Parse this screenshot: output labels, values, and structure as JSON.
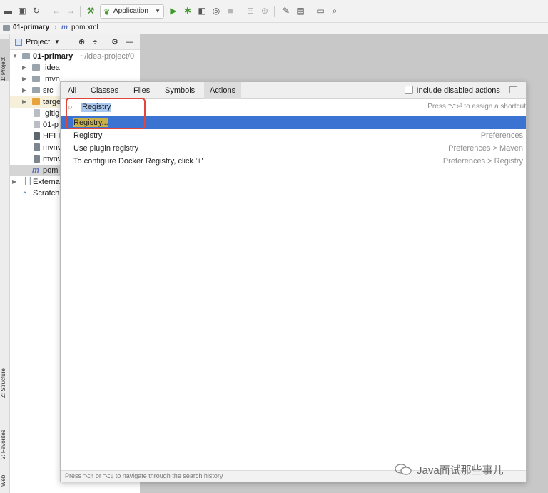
{
  "toolbar": {
    "run_config": "Application",
    "icons": [
      "folder-open-icon",
      "save-icon",
      "sync-icon",
      "back-arrow-icon",
      "forward-arrow-icon",
      "build-hammer-icon",
      "run-icon",
      "debug-icon",
      "coverage-icon",
      "profile-icon",
      "stop-icon",
      "attach-icon",
      "structure-icon",
      "wrench-icon",
      "project-structure-icon",
      "presentation-icon",
      "search-icon"
    ]
  },
  "breadcrumb": {
    "project": "01-primary",
    "file": "pom.xml"
  },
  "side_tabs": {
    "project": "1: Project",
    "structure": "Z: Structure",
    "favorites": "2: Favorites",
    "web": "Web"
  },
  "project_panel": {
    "title": "Project",
    "root": {
      "name": "01-primary",
      "path": "~/idea-project/0"
    },
    "items": [
      ".idea",
      ".mvn",
      "src",
      "targe",
      ".gitig",
      "01-p",
      "HELI",
      "mvnv",
      "mvnv",
      "pom",
      "Externa",
      "Scratch"
    ]
  },
  "popup": {
    "tabs": [
      "All",
      "Classes",
      "Files",
      "Symbols",
      "Actions"
    ],
    "active_tab": "Actions",
    "include_disabled": "Include disabled actions",
    "search_value": "Registry",
    "shortcut_hint": "Press ⌥⏎ to assign a shortcut",
    "results": [
      {
        "name": "Registry...",
        "location": ""
      },
      {
        "name": "Registry",
        "location": "Preferences"
      },
      {
        "name": "Use plugin registry",
        "location": "Preferences > Maven"
      },
      {
        "name": "To configure Docker Registry, click '+'",
        "location": "Preferences > Registry"
      }
    ],
    "footer": "Press ⌥↑ or ⌥↓ to navigate through the search history"
  },
  "watermark": "Java面试那些事儿",
  "colors": {
    "selection": "#3b73d2",
    "highlight": "#c8b04a",
    "annotation": "#e0463c"
  }
}
